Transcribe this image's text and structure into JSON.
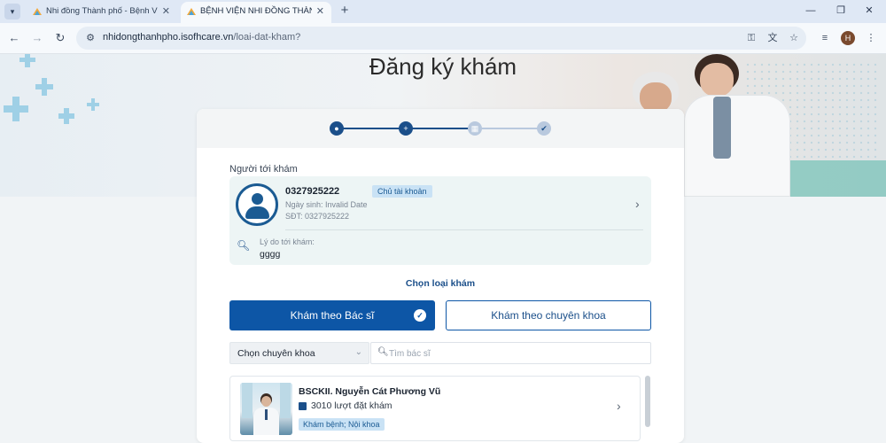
{
  "browser": {
    "tabs": [
      {
        "title": "Nhi đồng Thành phố - Bệnh Việ",
        "active": false
      },
      {
        "title": "BỆNH VIỆN NHI ĐỒNG THÀNH",
        "active": true
      }
    ],
    "new_tab": "+",
    "url_host": "nhidongthanhpho.isofhcare.vn",
    "url_path": "/loai-dat-kham?",
    "profile_initial": "H",
    "tab_close": "✕"
  },
  "page": {
    "title": "Đăng ký khám",
    "steps": [
      {
        "name": "patient",
        "state": "done"
      },
      {
        "name": "service",
        "state": "done"
      },
      {
        "name": "schedule",
        "state": "todo"
      },
      {
        "name": "confirm",
        "state": "todo"
      }
    ],
    "patient_label": "Người tới khám",
    "patient": {
      "phone": "0327925222",
      "badge": "Chủ tài khoản",
      "dob": "Ngày sinh: Invalid Date",
      "sdt": "SĐT: 0327925222",
      "reason_label": "Lý do tới khám:",
      "reason_value": "gggg"
    },
    "choose_type_label": "Chọn loại khám",
    "type_buttons": {
      "by_doctor": "Khám theo Bác sĩ",
      "by_specialty": "Khám theo chuyên khoa"
    },
    "filter": {
      "specialty_select": "Chọn chuyên khoa",
      "search_placeholder": "Tìm bác sĩ"
    },
    "doctors": [
      {
        "name": "BSCKII. Nguyễn Cát Phương Vũ",
        "bookings": "3010 lượt đặt khám",
        "tag": "Khám bệnh; Nội khoa"
      }
    ]
  },
  "colors": {
    "primary": "#0d56a6",
    "step_done": "#1b4f8a",
    "step_todo": "#b9c9de",
    "badge_bg": "#c9e2f5"
  }
}
